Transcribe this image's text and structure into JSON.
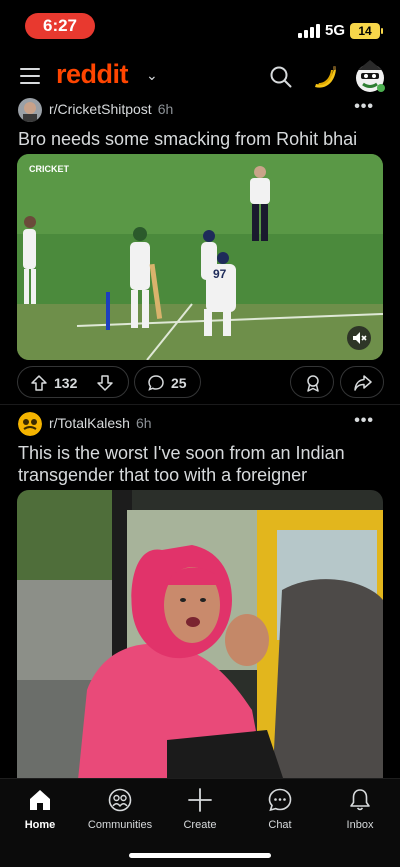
{
  "status_bar": {
    "time": "6:27",
    "network": "5G",
    "battery": "14"
  },
  "header": {
    "logo_text": "reddit",
    "icons": [
      "menu-icon",
      "chevron-down-icon",
      "search-icon",
      "banana-icon",
      "avatar-icon"
    ],
    "brand_color": "#ff4500"
  },
  "posts": [
    {
      "subreddit": "r/CricketShitpost",
      "age": "6h",
      "title": "Bro needs some smacking from Rohit bhai",
      "media_watermark": "CRICKET",
      "upvotes": "132",
      "comments": "25"
    },
    {
      "subreddit": "r/TotalKalesh",
      "age": "6h",
      "title": "This is the worst I've soon from an Indian transgender that too with a foreigner"
    }
  ],
  "tab_bar": {
    "items": [
      {
        "label": "Home",
        "icon": "home-icon",
        "active": true
      },
      {
        "label": "Communities",
        "icon": "communities-icon",
        "active": false
      },
      {
        "label": "Create",
        "icon": "plus-icon",
        "active": false
      },
      {
        "label": "Chat",
        "icon": "chat-icon",
        "active": false
      },
      {
        "label": "Inbox",
        "icon": "bell-icon",
        "active": false
      }
    ]
  }
}
